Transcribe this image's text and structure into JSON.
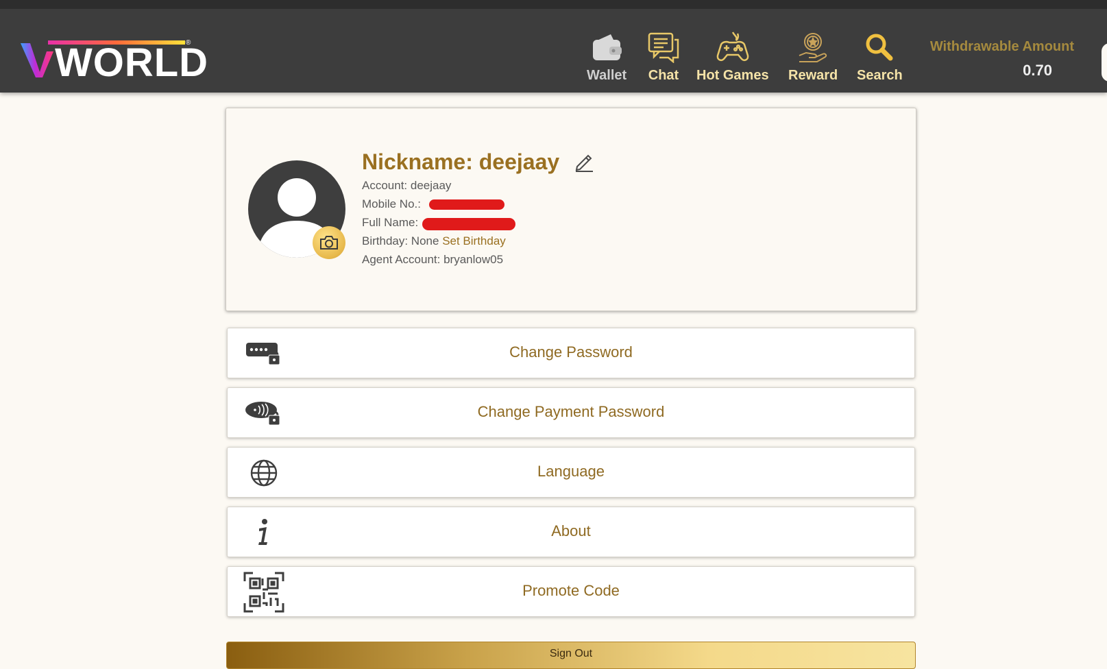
{
  "header": {
    "logo_text": "WORLD",
    "logo_mark": "V",
    "nav": [
      {
        "label": "Wallet",
        "icon": "wallet-icon",
        "color": "#cfcfcf"
      },
      {
        "label": "Chat",
        "icon": "chat-icon",
        "color": "#f5e3a8"
      },
      {
        "label": "Hot Games",
        "icon": "gamepad-icon",
        "color": "#f5e3a8"
      },
      {
        "label": "Reward",
        "icon": "reward-icon",
        "color": "#f5e3a8"
      },
      {
        "label": "Search",
        "icon": "search-icon",
        "color": "#f5e3a8"
      }
    ],
    "withdrawable_label": "Withdrawable Amount",
    "withdrawable_value": "0.70"
  },
  "profile": {
    "nickname_label": "Nickname: deejaay",
    "account": "Account: deejaay",
    "mobile_label": "Mobile No.:",
    "fullname_label": "Full Name:",
    "birthday": "Birthday: None",
    "set_birthday": "Set Birthday",
    "agent": "Agent Account: bryanlow05"
  },
  "menu": [
    {
      "label": "Change Password",
      "icon": "password-lock-icon"
    },
    {
      "label": "Change Payment Password",
      "icon": "payment-lock-icon"
    },
    {
      "label": "Language",
      "icon": "globe-icon"
    },
    {
      "label": "About",
      "icon": "info-icon"
    },
    {
      "label": "Promote Code",
      "icon": "qr-code-icon"
    }
  ],
  "signout_label": "Sign Out",
  "colors": {
    "header_bg": "#3d3d3d",
    "accent_gold": "#9a7021",
    "page_bg": "#fcf9f3",
    "redaction": "#e01a1a"
  }
}
